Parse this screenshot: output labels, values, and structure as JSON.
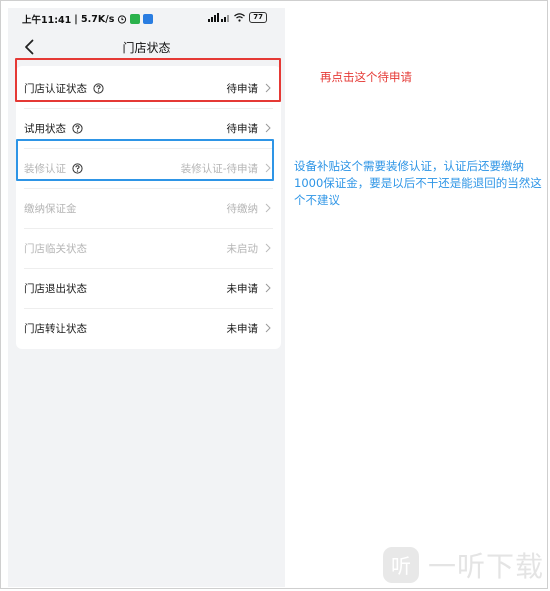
{
  "status_bar": {
    "time_text": "上午11:41",
    "speed_text": "| 5.7K/s",
    "battery_text": "77"
  },
  "nav": {
    "title": "门店状态"
  },
  "rows": [
    {
      "label": "门店认证状态",
      "status": "待申请",
      "has_help": true,
      "disabled": false
    },
    {
      "label": "试用状态",
      "status": "待申请",
      "has_help": true,
      "disabled": false
    },
    {
      "label": "装修认证",
      "status": "装修认证-待申请",
      "has_help": true,
      "disabled": true
    },
    {
      "label": "缴纳保证金",
      "status": "待缴纳",
      "has_help": false,
      "disabled": true
    },
    {
      "label": "门店临关状态",
      "status": "未启动",
      "has_help": false,
      "disabled": true
    },
    {
      "label": "门店退出状态",
      "status": "未申请",
      "has_help": false,
      "disabled": false
    },
    {
      "label": "门店转让状态",
      "status": "未申请",
      "has_help": false,
      "disabled": false
    }
  ],
  "annotations": {
    "red_note": "再点击这个待申请",
    "blue_note": "设备补贴这个需要装修认证，认证后还要缴纳1000保证金，要是以后不干还是能退回的当然这个不建议"
  },
  "watermark": {
    "text": "一听下载",
    "logo_icon": "watermark-logo-icon"
  },
  "colors": {
    "annotation_red": "#e53935",
    "annotation_blue": "#2e95e6",
    "disabled_text": "#b5b5b5",
    "page_bg": "#f2f3f5"
  }
}
